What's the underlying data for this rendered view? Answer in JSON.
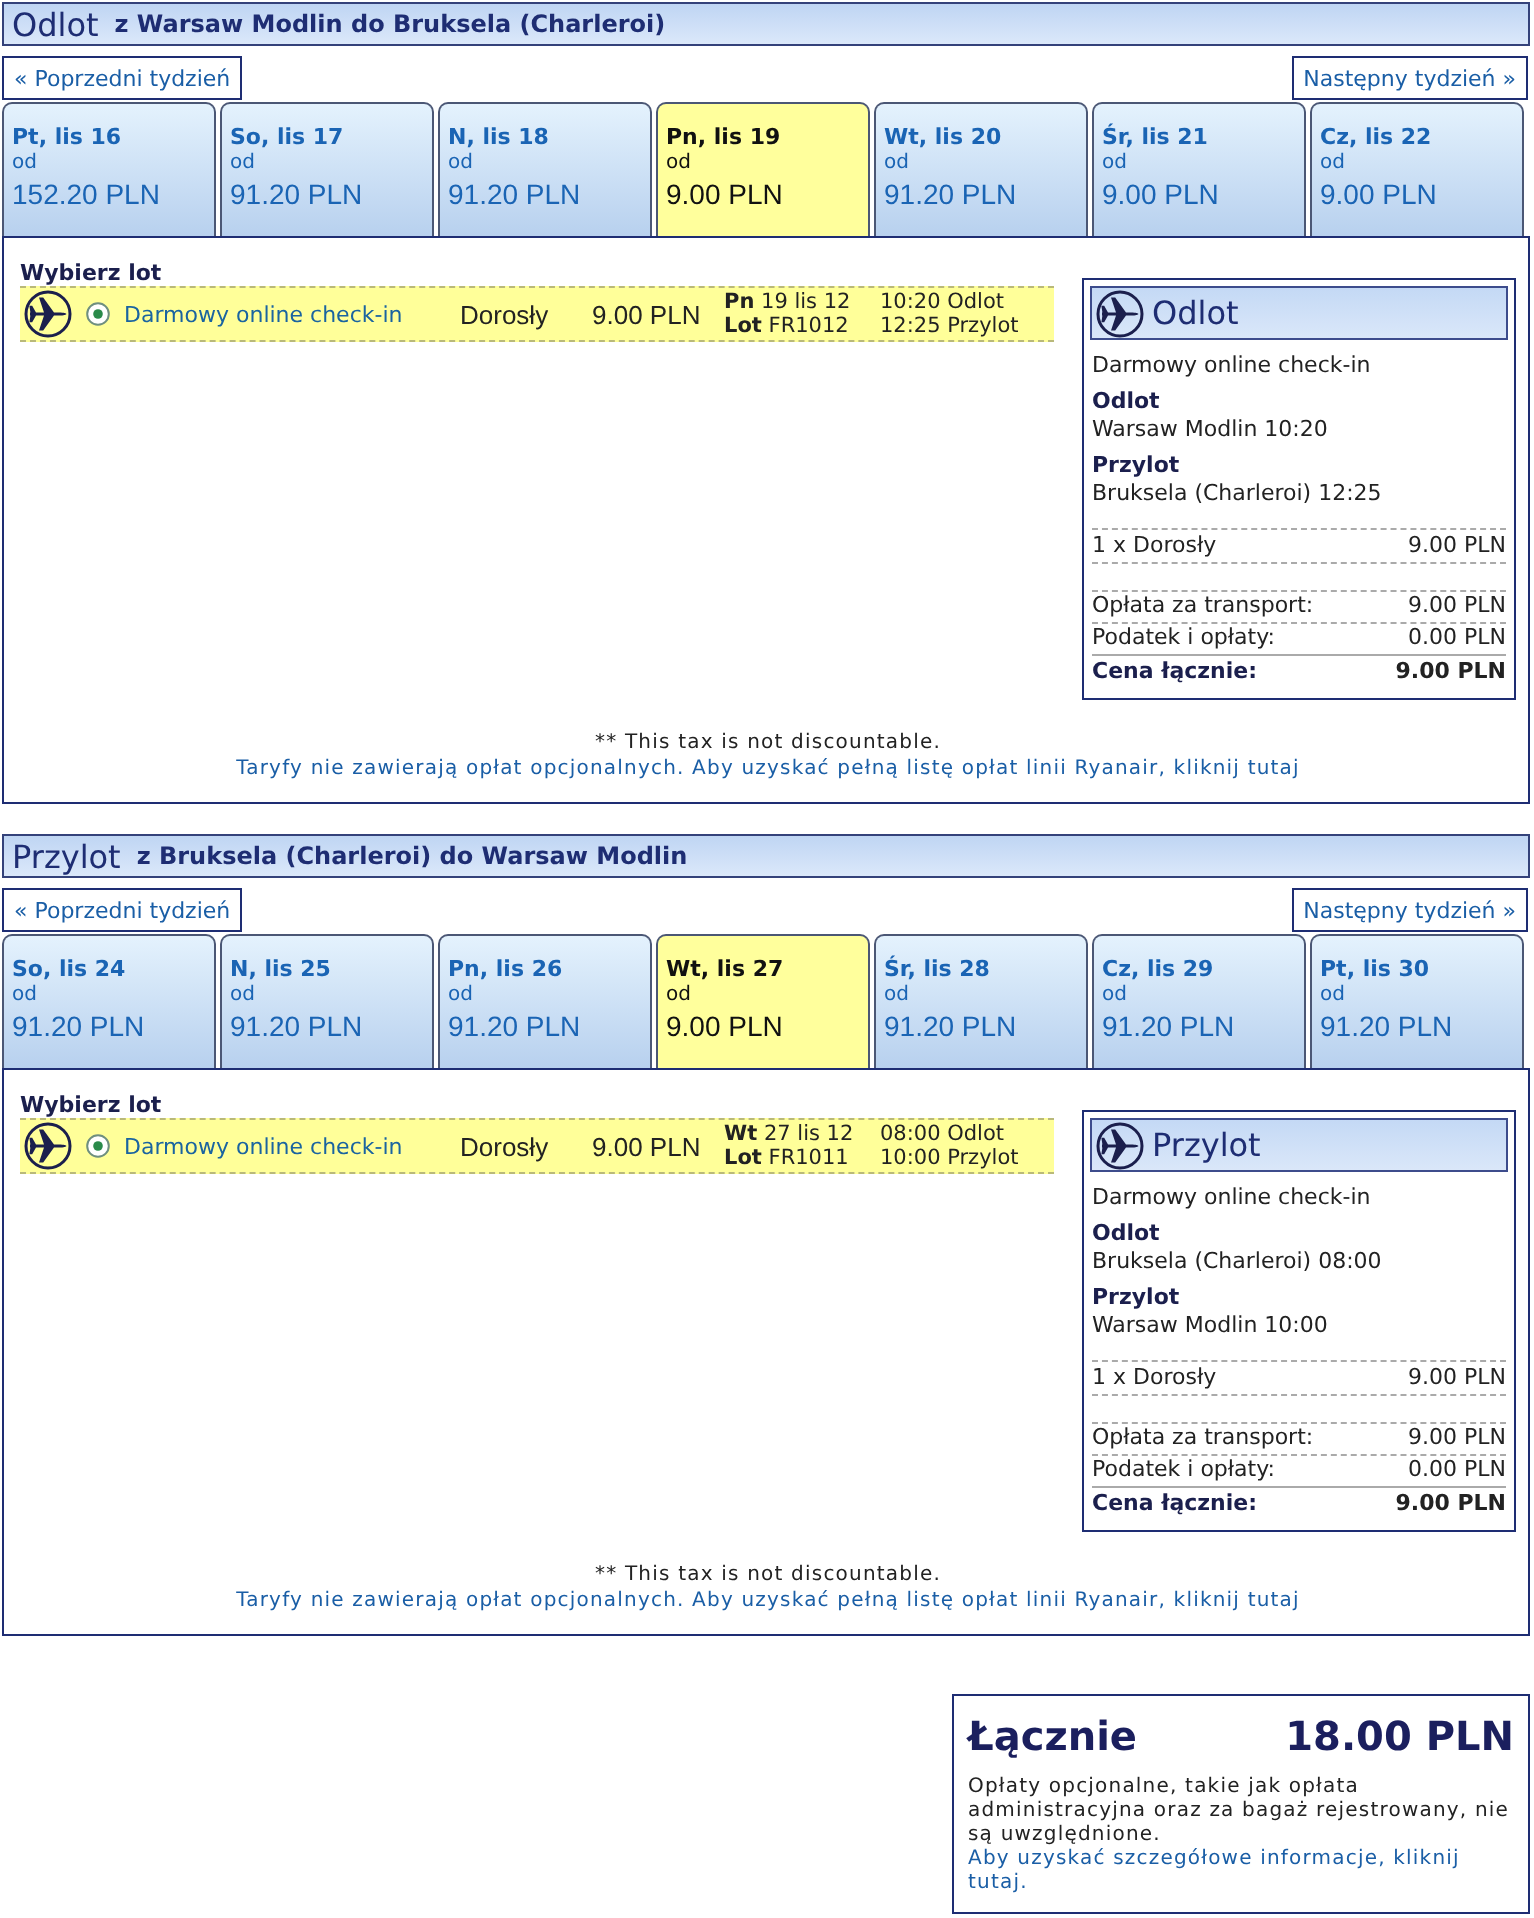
{
  "sections": [
    {
      "title": "Odlot",
      "route": "z Warsaw Modlin do Bruksela (Charleroi)",
      "prev_week": "« Poprzedni tydzień",
      "next_week": "Następny tydzień »",
      "days": [
        {
          "label": "Pt, lis 16",
          "from": "od",
          "price": "152.20 PLN",
          "selected": false
        },
        {
          "label": "So, lis 17",
          "from": "od",
          "price": "91.20 PLN",
          "selected": false
        },
        {
          "label": "N, lis 18",
          "from": "od",
          "price": "91.20 PLN",
          "selected": false
        },
        {
          "label": "Pn, lis 19",
          "from": "od",
          "price": "9.00 PLN",
          "selected": true
        },
        {
          "label": "Wt, lis 20",
          "from": "od",
          "price": "91.20 PLN",
          "selected": false
        },
        {
          "label": "Śr, lis 21",
          "from": "od",
          "price": "9.00 PLN",
          "selected": false
        },
        {
          "label": "Cz, lis 22",
          "from": "od",
          "price": "9.00 PLN",
          "selected": false
        }
      ],
      "choose_label": "Wybierz lot",
      "flights": [
        {
          "selected": true,
          "fare": "Darmowy online check-in",
          "passenger": "Dorosły",
          "price": "9.00 PLN",
          "date": "**Pn** 19 lis 12",
          "flight": "**Lot** FR1012",
          "departure": "10:20 Odlot",
          "arrival": "12:25 Przylot"
        }
      ],
      "summary": {
        "title": "Odlot",
        "fare": "Darmowy online check-in",
        "legs": [
          {
            "label": "Odlot",
            "detail": "Warsaw Modlin 10:20"
          },
          {
            "label": "Przylot",
            "detail": "Bruksela (Charleroi) 12:25"
          }
        ],
        "passenger": {
          "label": "1 x Dorosły",
          "value": "9.00 PLN"
        },
        "charges": [
          {
            "label": "Opłata za transport:",
            "value": "9.00 PLN"
          },
          {
            "label": "Podatek i opłaty:",
            "value": "0.00 PLN"
          }
        ],
        "total": {
          "label": "Cena łącznie:",
          "value": "9.00 PLN"
        }
      },
      "tax_note": "** This tax is not discountable.",
      "fees_link": "Taryfy nie zawierają opłat opcjonalnych. Aby uzyskać pełną listę opłat linii Ryanair, kliknij tutaj"
    },
    {
      "title": "Przylot",
      "route": "z Bruksela (Charleroi) do Warsaw Modlin",
      "prev_week": "« Poprzedni tydzień",
      "next_week": "Następny tydzień »",
      "days": [
        {
          "label": "So, lis 24",
          "from": "od",
          "price": "91.20 PLN",
          "selected": false
        },
        {
          "label": "N, lis 25",
          "from": "od",
          "price": "91.20 PLN",
          "selected": false
        },
        {
          "label": "Pn, lis 26",
          "from": "od",
          "price": "91.20 PLN",
          "selected": false
        },
        {
          "label": "Wt, lis 27",
          "from": "od",
          "price": "9.00 PLN",
          "selected": true
        },
        {
          "label": "Śr, lis 28",
          "from": "od",
          "price": "91.20 PLN",
          "selected": false
        },
        {
          "label": "Cz, lis 29",
          "from": "od",
          "price": "91.20 PLN",
          "selected": false
        },
        {
          "label": "Pt, lis 30",
          "from": "od",
          "price": "91.20 PLN",
          "selected": false
        }
      ],
      "choose_label": "Wybierz lot",
      "flights": [
        {
          "selected": true,
          "fare": "Darmowy online check-in",
          "passenger": "Dorosły",
          "price": "9.00 PLN",
          "date": "**Wt** 27 lis 12",
          "flight": "**Lot** FR1011",
          "departure": "08:00 Odlot",
          "arrival": "10:00 Przylot"
        }
      ],
      "summary": {
        "title": "Przylot",
        "fare": "Darmowy online check-in",
        "legs": [
          {
            "label": "Odlot",
            "detail": "Bruksela (Charleroi) 08:00"
          },
          {
            "label": "Przylot",
            "detail": "Warsaw Modlin 10:00"
          }
        ],
        "passenger": {
          "label": "1 x Dorosły",
          "value": "9.00 PLN"
        },
        "charges": [
          {
            "label": "Opłata za transport:",
            "value": "9.00 PLN"
          },
          {
            "label": "Podatek i opłaty:",
            "value": "0.00 PLN"
          }
        ],
        "total": {
          "label": "Cena łącznie:",
          "value": "9.00 PLN"
        }
      },
      "tax_note": "** This tax is not discountable.",
      "fees_link": "Taryfy nie zawierają opłat opcjonalnych. Aby uzyskać pełną listę opłat linii Ryanair, kliknij tutaj"
    }
  ],
  "grand_total": {
    "label": "Łącznie",
    "value": "18.00 PLN",
    "note": "Opłaty opcjonalne, takie jak opłata administracyjna oraz za bagaż rejestrowany, nie są uwzględnione.",
    "link": "Aby uzyskać szczegółowe informacje, kliknij tutaj."
  }
}
